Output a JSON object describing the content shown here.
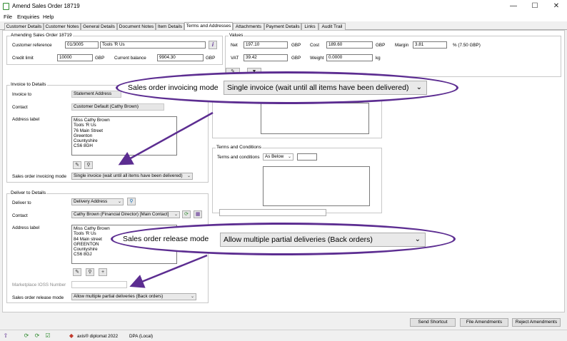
{
  "window": {
    "title": "Amend Sales Order 18719",
    "minimize_glyph": "—",
    "maximize_glyph": "☐",
    "close_glyph": "✕"
  },
  "menu": [
    "File",
    "Enquiries",
    "Help"
  ],
  "tabs": [
    "Customer Details",
    "Customer Notes",
    "General Details",
    "Document Notes",
    "Item Details",
    "Terms and Addresses",
    "Attachments",
    "Payment Details",
    "Links",
    "Audit Trail"
  ],
  "active_tab": "Terms and Addresses",
  "amending": {
    "title": "Amending Sales Order 18719",
    "customer_reference_label": "Customer reference",
    "customer_reference_value": "01/3005",
    "customer_name": "Tools 'R Us",
    "credit_limit_label": "Credit limit",
    "credit_limit_value": "10000",
    "credit_currency": "GBP",
    "current_balance_label": "Current balance",
    "current_balance_value": "9904.30",
    "balance_currency": "GBP"
  },
  "values": {
    "title": "Values",
    "net_label": "Net",
    "net_value": "197.10",
    "net_currency": "GBP",
    "cost_label": "Cost",
    "cost_value": "189.60",
    "cost_currency": "GBP",
    "margin_label": "Margin",
    "margin_value": "3.81",
    "margin_suffix": "%  (7.50 GBP)",
    "vat_label": "VAT",
    "vat_value": "39.42",
    "vat_currency": "GBP",
    "weight_label": "Weight",
    "weight_value": "0.0000",
    "weight_unit": "kg"
  },
  "invoice": {
    "title": "Invoice to Details",
    "invoice_to_label": "Invoice to",
    "invoice_to_value": "Statement Address",
    "contact_label": "Contact",
    "contact_value": "Customer Default (Cathy Brown)",
    "address_label": "Address label",
    "address_lines": [
      "Miss Cathy Brown",
      "Tools 'R Us",
      "76 Main Street",
      "Greenton",
      "Countyshire",
      "CS6 8GH"
    ],
    "invoicing_mode_label": "Sales order invoicing mode",
    "invoicing_mode_value": "Single invoice (wait until all items have been delivered)"
  },
  "deliver": {
    "title": "Deliver to Details",
    "deliver_to_label": "Deliver to",
    "deliver_to_value": "Delivery Address",
    "contact_label": "Contact",
    "contact_value": "Cathy Brown (Financial Director) [Main Contact]",
    "address_label": "Address label",
    "address_lines": [
      "Miss Cathy Brown",
      "Tools 'R Us",
      "84 Main street",
      "GREENTON",
      "Countyshire",
      "CS6 8GJ"
    ],
    "ioss_label": "Marketplace IOSS Number",
    "ioss_value": "",
    "release_mode_label": "Sales order release mode",
    "release_mode_value": "Allow multiple partial deliveries (Back orders)"
  },
  "terms": {
    "title": "Terms and Conditions",
    "terms_label": "Terms and conditions",
    "terms_value": "As Below"
  },
  "callouts": {
    "invoicing": {
      "label": "Sales order invoicing mode",
      "value": "Single invoice (wait until all items have been delivered)"
    },
    "release": {
      "label": "Sales order release mode",
      "value": "Allow multiple partial deliveries (Back orders)"
    }
  },
  "buttons": {
    "send_shortcut": "Send Shortcut",
    "file_amendments": "File Amendments",
    "reject_amendments": "Reject Amendments"
  },
  "status": {
    "product": "axis® diplomat 2022",
    "database": "DPA (Local)"
  },
  "colors": {
    "callout_border": "#5c2d91",
    "arrow": "#5c2d91"
  }
}
